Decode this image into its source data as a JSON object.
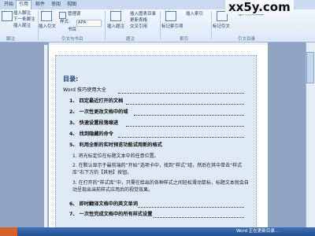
{
  "tabs": [
    "开始",
    "引用",
    "邮件",
    "审阅",
    "视图"
  ],
  "active_tab": 1,
  "ribbon": {
    "footnote_insert": "插入脚注",
    "next_footnote": "下一条脚注",
    "insert_endnote": "插入尾注",
    "insert_citation": "插入引文",
    "manage_sources": "管理源",
    "style_label": "样式:",
    "style_value": "APA",
    "bibliography": "书目",
    "insert_caption": "插入题注",
    "insert_table_of_figures": "插入图表目录",
    "update_table": "更新表格",
    "cross_reference": "交叉引用",
    "mark_entry": "标记索引项",
    "insert_index": "插入索引",
    "mark_citation": "标记引文",
    "insert_table_of_authorities": "插入引文目录",
    "group_footnotes": "脚注",
    "group_citations": "引文与书目",
    "group_captions": "题注",
    "group_index": "索引",
    "group_authorities": "引文目录"
  },
  "watermark": "xx5y.com",
  "document": {
    "toc_heading": "目录:",
    "toc_title": "Word 技巧使用大全",
    "toc_items": [
      "1、 四定最近打开的文档",
      "2、 一次性更改文档中的域",
      "3、 快速设置段落缩进",
      "4、 找到隐藏的命令",
      "5、 利用全新的实时预览功能试用新的格式"
    ],
    "para1": "1. 将光标定位在标题文本中的任意位置。",
    "para2": "2. 在默认显示于最前端的“开始”选项卡中，找到“样式”组，然后在其中单击“样式库”右下方的【其他】按钮。",
    "para3": "3. 在打开的“样式库”中，只需在给出的各种样式之间轻松滑动鼠标，标题文本就会自动呈现出当前样式应用后的视觉效果。",
    "toc_items2": [
      "6、 即时翻译文档中的英文单词",
      "7、 一次性完成文档中的所有样式设置"
    ]
  },
  "status_text": "Word 正在更新目录..."
}
